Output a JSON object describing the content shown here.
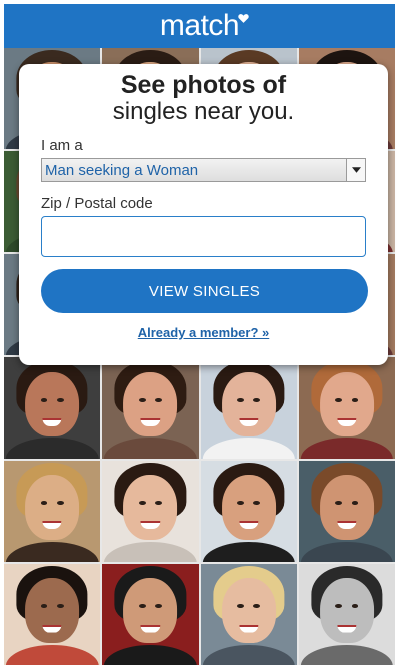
{
  "brand": {
    "name": "match",
    "color": "#1f74c4",
    "icon": "heart-icon"
  },
  "card": {
    "headline_line1": "See photos of",
    "headline_line2": "singles near you.",
    "gender_label": "I am a",
    "gender_select": {
      "value": "Man seeking a Woman"
    },
    "zip_label": "Zip / Postal code",
    "zip_input": {
      "value": "",
      "placeholder": ""
    },
    "cta_label": "VIEW SINGLES",
    "member_link": "Already a member? »"
  },
  "photo_grid": {
    "tiles": [
      {
        "skin": "#c98f6a",
        "hair": "#3a2a1f",
        "bg": "#6b7a84",
        "top": "#2f3a45"
      },
      {
        "skin": "#d9a682",
        "hair": "#2a1c14",
        "bg": "#8a6e58",
        "top": "#5a3b2c"
      },
      {
        "skin": "#e2b396",
        "hair": "#5a3a24",
        "bg": "#b9c3cc",
        "top": "#1e3b66"
      },
      {
        "skin": "#dba98c",
        "hair": "#1d1410",
        "bg": "#a77c62",
        "top": "#6b3a3a"
      },
      {
        "skin": "#c48868",
        "hair": "#6a4a30",
        "bg": "#3b5c34",
        "top": "#2e4a2a"
      },
      {
        "skin": "#d8a585",
        "hair": "#2a1a12",
        "bg": "#8a8a8a",
        "top": "#444444"
      },
      {
        "skin": "#e0b295",
        "hair": "#3a2518",
        "bg": "#9aa7b0",
        "top": "#333a40"
      },
      {
        "skin": "#d39c7c",
        "hair": "#241712",
        "bg": "#c9b4a3",
        "top": "#7a2f2f"
      },
      {
        "skin": "#c98f6a",
        "hair": "#2d2018",
        "bg": "#6b7a84",
        "top": "#2f3a45"
      },
      {
        "skin": "#d9a682",
        "hair": "#3a2516",
        "bg": "#876650",
        "top": "#5a3b2c"
      },
      {
        "skin": "#e2b396",
        "hair": "#6a4a30",
        "bg": "#b8c2cb",
        "top": "#23324a"
      },
      {
        "skin": "#dba98c",
        "hair": "#1d1410",
        "bg": "#a37a60",
        "top": "#6b3a3a"
      },
      {
        "skin": "#b9775a",
        "hair": "#2a1a12",
        "bg": "#3e3e3e",
        "top": "#2b2b2b"
      },
      {
        "skin": "#dca184",
        "hair": "#2e1c12",
        "bg": "#7b6353",
        "top": "#6a4a3c"
      },
      {
        "skin": "#e3b39a",
        "hair": "#2a1a12",
        "bg": "#c8d2dc",
        "top": "#f2f2f2"
      },
      {
        "skin": "#e1a88c",
        "hair": "#b06a3a",
        "bg": "#8c6a52",
        "top": "#7a2a2a"
      },
      {
        "skin": "#dcae86",
        "hair": "#c79a56",
        "bg": "#b89870",
        "top": "#3a2a20"
      },
      {
        "skin": "#e6b99c",
        "hair": "#2a1a12",
        "bg": "#e8e2dc",
        "top": "#c8c0b8"
      },
      {
        "skin": "#d8a07e",
        "hair": "#2a1a12",
        "bg": "#d6dde3",
        "top": "#1e1e1e"
      },
      {
        "skin": "#cf9472",
        "hair": "#7a4a2a",
        "bg": "#4a5e68",
        "top": "#3a4650"
      },
      {
        "skin": "#9c6a4e",
        "hair": "#1a120e",
        "bg": "#e8d4c2",
        "top": "#c04a3a"
      },
      {
        "skin": "#cf9a78",
        "hair": "#1a1a1a",
        "bg": "#8a1e1e",
        "top": "#1a1a1a"
      },
      {
        "skin": "#e6bca0",
        "hair": "#e4cc8c",
        "bg": "#7a8a96",
        "top": "#4a5560"
      },
      {
        "skin": "#bdbdbd",
        "hair": "#2a2a2a",
        "bg": "#dcdcdc",
        "top": "#6a6a6a"
      }
    ]
  }
}
